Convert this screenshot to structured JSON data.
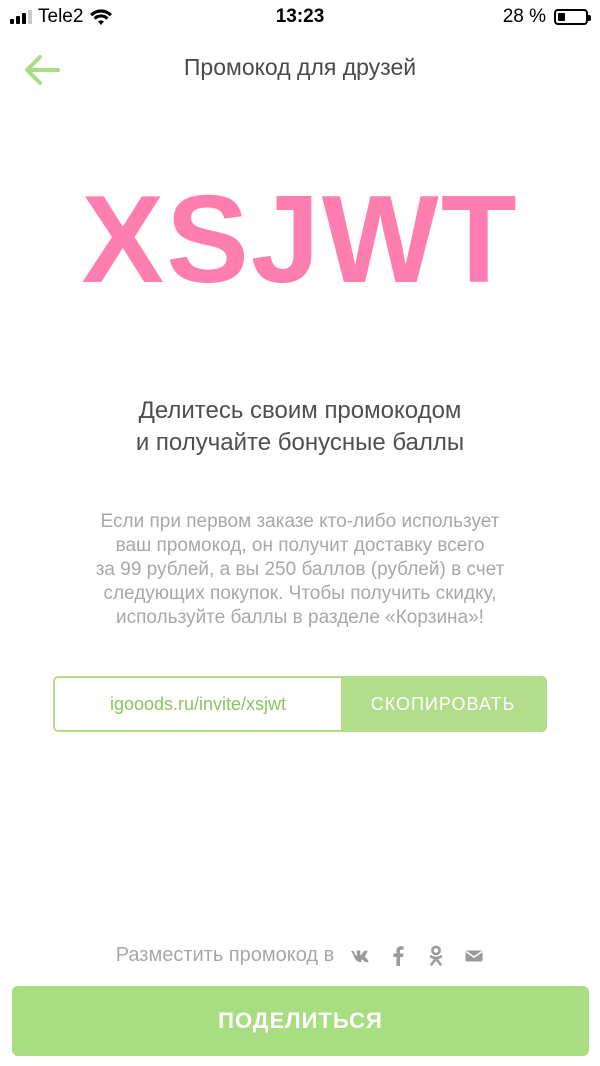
{
  "status_bar": {
    "carrier": "Tele2",
    "time": "13:23",
    "battery": "28 %",
    "battery_level": 0.28
  },
  "header": {
    "title": "Промокод для друзей",
    "back_icon": "arrow-left-icon"
  },
  "promo": {
    "code": "XSJWT",
    "headline_line1": "Делитесь своим промокодом",
    "headline_line2": "и получайте бонусные баллы",
    "description_lines": [
      "Если при первом заказе кто-либо использует",
      "ваш промокод, он получит доставку всего",
      "за 99 рублей, а вы 250 баллов (рублей) в счет",
      "следующих покупок. Чтобы получить скидку,",
      "используйте баллы в разделе «Корзина»!"
    ]
  },
  "invite": {
    "link": "igooods.ru/invite/xsjwt",
    "copy_label": "СКОПИРОВАТЬ"
  },
  "share": {
    "label": "Разместить промокод в",
    "networks": [
      {
        "name": "vk-icon",
        "glyph": "vk"
      },
      {
        "name": "facebook-icon",
        "glyph": "f"
      },
      {
        "name": "odnoklassniki-icon",
        "glyph": "ok"
      },
      {
        "name": "mail-icon",
        "glyph": "mail"
      }
    ],
    "button_label": "ПОДЕЛИТЬСЯ"
  },
  "colors": {
    "accent_green": "#a9dd81",
    "promo_pink": "#ff7eb0",
    "link_green": "#88c55f"
  }
}
